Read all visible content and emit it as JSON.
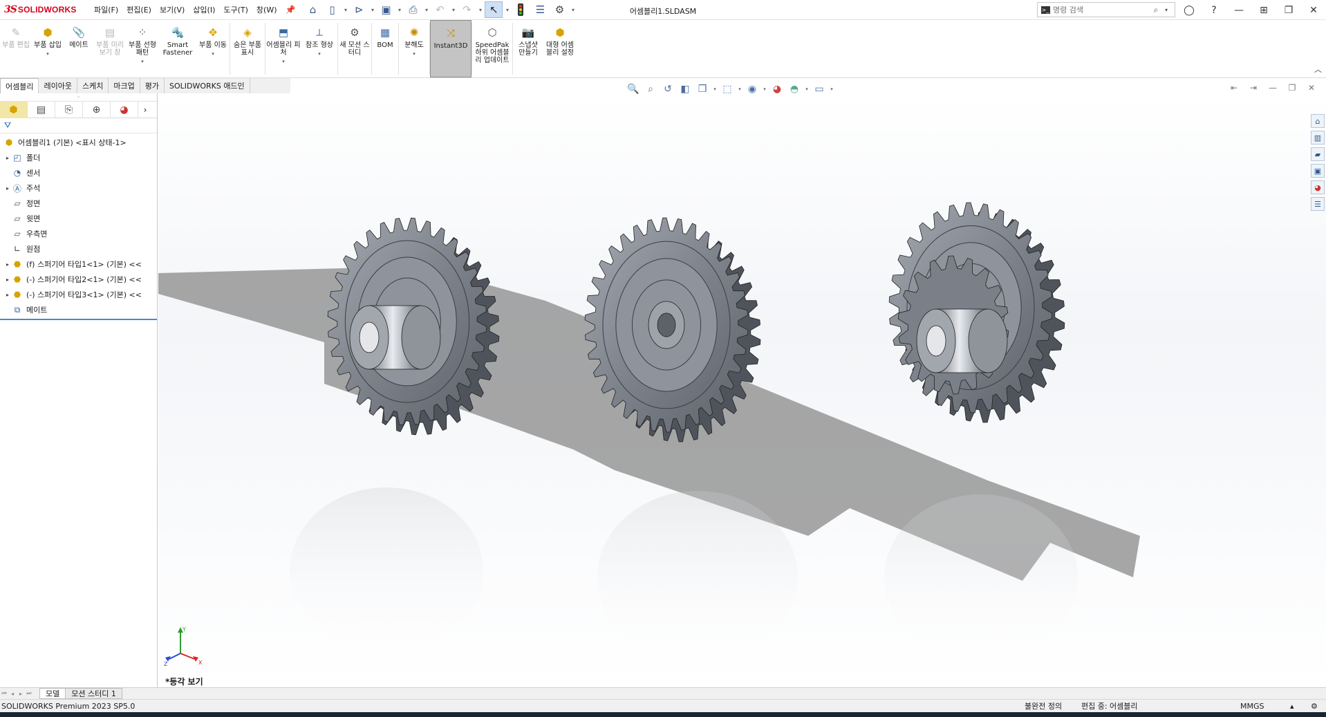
{
  "app": {
    "brand": "SOLIDWORKS",
    "brand_prefix": "3S",
    "document_title": "어셈블리1.SLDASM",
    "accent_color": "#d7001b"
  },
  "menus": [
    "파일(F)",
    "편집(E)",
    "보기(V)",
    "삽입(I)",
    "도구(T)",
    "창(W)"
  ],
  "quick_access": [
    "home-icon",
    "new-document-icon",
    "open-icon",
    "save-icon",
    "print-icon",
    "undo-icon",
    "redo-icon",
    "select-icon",
    "rebuild-icon",
    "file-properties-icon",
    "options-icon"
  ],
  "search": {
    "placeholder": "명령 검색"
  },
  "command_manager": [
    {
      "label": "부품 편집",
      "icon": "edit-part-icon",
      "disabled": true
    },
    {
      "label": "부품 삽입",
      "icon": "insert-component-icon",
      "disabled": false,
      "dropdown": true
    },
    {
      "label": "메이트",
      "icon": "mate-icon",
      "disabled": false
    },
    {
      "label": "부품 미리보기 창",
      "icon": "component-preview-icon",
      "disabled": true
    },
    {
      "label": "부품 선형 패턴",
      "icon": "linear-pattern-icon",
      "disabled": false,
      "dropdown": true
    },
    {
      "label": "Smart Fastener",
      "icon": "smart-fastener-icon",
      "disabled": false
    },
    {
      "label": "부품 이동",
      "icon": "move-component-icon",
      "disabled": false,
      "dropdown": true
    },
    {
      "label": "숨은 부품 표시",
      "icon": "show-hidden-icon",
      "disabled": false
    },
    {
      "label": "어셈블리 피처",
      "icon": "assembly-feature-icon",
      "disabled": false,
      "dropdown": true
    },
    {
      "label": "참조 형상",
      "icon": "reference-geometry-icon",
      "disabled": false,
      "dropdown": true
    },
    {
      "label": "새 모션 스터디",
      "icon": "motion-study-icon",
      "disabled": false
    },
    {
      "label": "BOM",
      "icon": "bom-icon",
      "disabled": false
    },
    {
      "label": "분해도",
      "icon": "exploded-view-icon",
      "disabled": false,
      "dropdown": true
    },
    {
      "label": "Instant3D",
      "icon": "instant3d-icon",
      "disabled": false,
      "active": true
    },
    {
      "label": "SpeedPak 하위 어셈블리 업데이트",
      "icon": "speedpak-icon",
      "disabled": false
    },
    {
      "label": "스냅샷 만들기",
      "icon": "snapshot-icon",
      "disabled": false
    },
    {
      "label": "대형 어셈블리 설정",
      "icon": "large-assembly-icon",
      "disabled": false
    }
  ],
  "tabs": [
    "어셈블리",
    "레이아웃",
    "스케치",
    "마크업",
    "평가",
    "SOLIDWORKS 애드인"
  ],
  "active_tab": "어셈블리",
  "feature_tree": {
    "root": "어셈블리1 (기본) <표시 상태-1>",
    "items": [
      {
        "label": "폴더",
        "icon": "history-folder-icon",
        "expandable": true
      },
      {
        "label": "센서",
        "icon": "sensor-icon",
        "expandable": false
      },
      {
        "label": "주석",
        "icon": "annotation-icon",
        "expandable": true
      },
      {
        "label": "정면",
        "icon": "plane-icon",
        "expandable": false
      },
      {
        "label": "윗면",
        "icon": "plane-icon",
        "expandable": false
      },
      {
        "label": "우측면",
        "icon": "plane-icon",
        "expandable": false
      },
      {
        "label": "원점",
        "icon": "origin-icon",
        "expandable": false
      },
      {
        "label": "(f) 스퍼기어 타입1<1> (기본) <<",
        "icon": "part-icon",
        "expandable": true
      },
      {
        "label": "(-) 스퍼기어 타입2<1> (기본) <<",
        "icon": "part-icon",
        "expandable": true
      },
      {
        "label": "(-) 스퍼기어 타입3<1> (기본) <<",
        "icon": "part-icon",
        "expandable": true
      },
      {
        "label": "메이트",
        "icon": "mates-folder-icon",
        "expandable": false
      }
    ]
  },
  "viewport": {
    "view_name": "*등각 보기",
    "gear_color": "#8e939c",
    "gear_dark": "#4f545c",
    "triad_labels": [
      "Y",
      "X",
      "Z"
    ]
  },
  "bottom_tabs": [
    "모델",
    "모션 스터디 1"
  ],
  "status": {
    "product": "SOLIDWORKS Premium 2023 SP5.0",
    "definition": "불완전 정의",
    "editing": "편집 중: 어셈블리",
    "units": "MMGS"
  }
}
